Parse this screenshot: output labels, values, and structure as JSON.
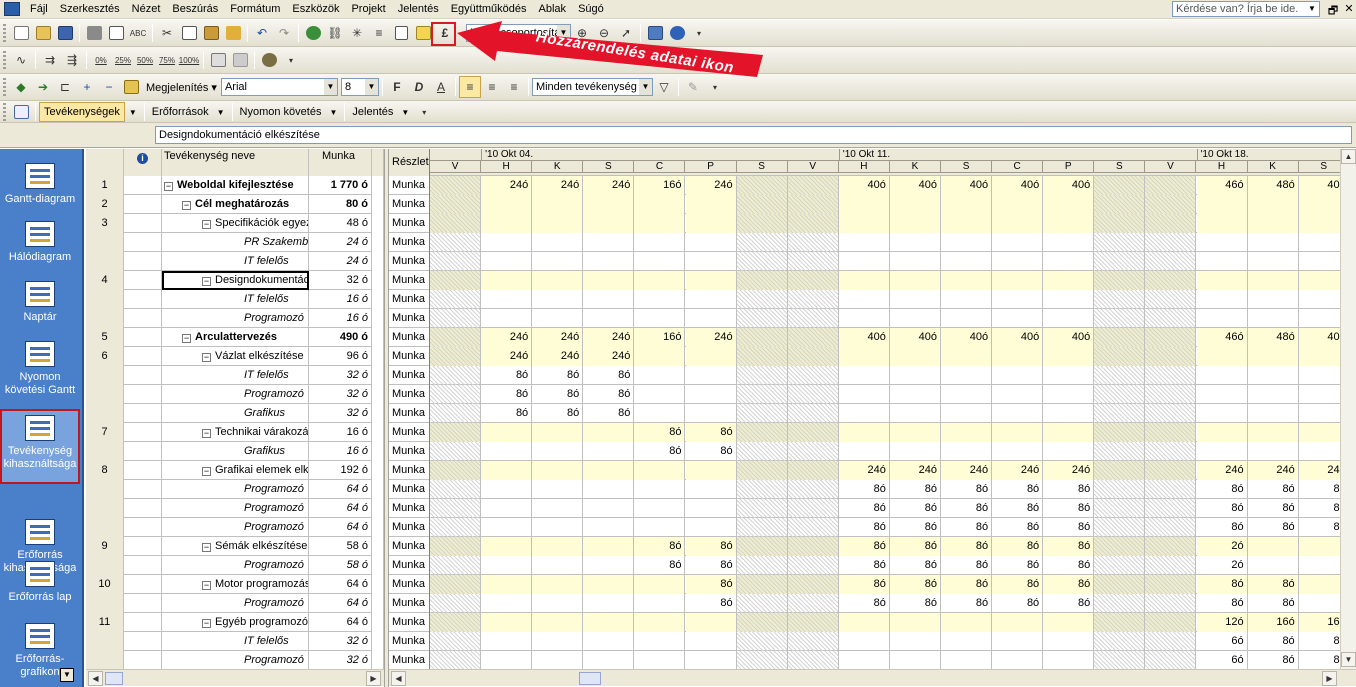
{
  "menu": {
    "items": [
      "Fájl",
      "Szerkesztés",
      "Nézet",
      "Beszúrás",
      "Formátum",
      "Eszközök",
      "Projekt",
      "Jelentés",
      "Együttműködés",
      "Ablak",
      "Súgó"
    ],
    "help_placeholder": "Kérdése van? Írja be ide."
  },
  "toolbar": {
    "grouping": "Nincs csoportosítás",
    "display_label": "Megjelenítés",
    "font": "Arial",
    "font_size": "8",
    "filter": "Minden tevékenység",
    "zoom_labels": [
      "0%",
      "25%",
      "50%",
      "75%",
      "100%"
    ],
    "bold": "F",
    "italic": "D",
    "underline": "A"
  },
  "viewtabs": {
    "tasks": "Tevékenységek",
    "resources": "Erőforrások",
    "tracking": "Nyomon követés",
    "report": "Jelentés"
  },
  "annotation": {
    "label": "Hozzárendelés adatai ikon",
    "color": "#e3142a"
  },
  "entry_value": "Designdokumentáció elkészítése",
  "viewbar": [
    {
      "label": "Gantt-diagram",
      "icon": "gantt-icon"
    },
    {
      "label": "Hálódiagram",
      "icon": "network-icon"
    },
    {
      "label": "Naptár",
      "icon": "calendar-icon"
    },
    {
      "label": "Nyomon követési Gantt",
      "icon": "tracking-gantt-icon"
    },
    {
      "label": "Tevékenység kihasználtsága",
      "icon": "task-usage-icon",
      "active": true
    },
    {
      "label": "Erőforrás kihasználtsága",
      "icon": "resource-usage-icon"
    },
    {
      "label": "Erőforrás lap",
      "icon": "resource-sheet-icon"
    },
    {
      "label": "Erőforrás-grafikon",
      "icon": "resource-graph-icon"
    }
  ],
  "table": {
    "headers": {
      "indicator": "i",
      "name": "Tevékenység neve",
      "work": "Munka"
    },
    "rows": [
      {
        "id": "1",
        "name": "Weboldal kifejlesztése",
        "work": "1 770 ó",
        "lvl": 0,
        "type": "sum"
      },
      {
        "id": "2",
        "name": "Cél meghatározás",
        "work": "80 ó",
        "lvl": 1,
        "type": "sum"
      },
      {
        "id": "3",
        "name": "Specifikációk egyeztetése",
        "work": "48 ó",
        "lvl": 2,
        "type": "task"
      },
      {
        "id": "",
        "name": "PR Szakember",
        "work": "24 ó",
        "lvl": 3,
        "type": "res"
      },
      {
        "id": "",
        "name": "IT felelős",
        "work": "24 ó",
        "lvl": 3,
        "type": "res"
      },
      {
        "id": "4",
        "name": "Designdokumentáció elkészítése",
        "work": "32 ó",
        "lvl": 2,
        "type": "task",
        "selected": true
      },
      {
        "id": "",
        "name": "IT felelős",
        "work": "16 ó",
        "lvl": 3,
        "type": "res"
      },
      {
        "id": "",
        "name": "Programozó",
        "work": "16 ó",
        "lvl": 3,
        "type": "res"
      },
      {
        "id": "5",
        "name": "Arculattervezés",
        "work": "490 ó",
        "lvl": 1,
        "type": "sum"
      },
      {
        "id": "6",
        "name": "Vázlat elkészítése",
        "work": "96 ó",
        "lvl": 2,
        "type": "task"
      },
      {
        "id": "",
        "name": "IT felelős",
        "work": "32 ó",
        "lvl": 3,
        "type": "res"
      },
      {
        "id": "",
        "name": "Programozó",
        "work": "32 ó",
        "lvl": 3,
        "type": "res"
      },
      {
        "id": "",
        "name": "Grafikus",
        "work": "32 ó",
        "lvl": 3,
        "type": "res"
      },
      {
        "id": "7",
        "name": "Technikai várakozás",
        "work": "16 ó",
        "lvl": 2,
        "type": "task"
      },
      {
        "id": "",
        "name": "Grafikus",
        "work": "16 ó",
        "lvl": 3,
        "type": "res"
      },
      {
        "id": "8",
        "name": "Grafikai elemek elkészítése",
        "work": "192 ó",
        "lvl": 2,
        "type": "task"
      },
      {
        "id": "",
        "name": "Programozó",
        "work": "64 ó",
        "lvl": 3,
        "type": "res"
      },
      {
        "id": "",
        "name": "Programozó",
        "work": "64 ó",
        "lvl": 3,
        "type": "res"
      },
      {
        "id": "",
        "name": "Programozó",
        "work": "64 ó",
        "lvl": 3,
        "type": "res"
      },
      {
        "id": "9",
        "name": "Sémák elkészítése",
        "work": "58 ó",
        "lvl": 2,
        "type": "task"
      },
      {
        "id": "",
        "name": "Programozó",
        "work": "58 ó",
        "lvl": 3,
        "type": "res"
      },
      {
        "id": "10",
        "name": "Motor programozása",
        "work": "64 ó",
        "lvl": 2,
        "type": "task"
      },
      {
        "id": "",
        "name": "Programozó",
        "work": "64 ó",
        "lvl": 3,
        "type": "res"
      },
      {
        "id": "11",
        "name": "Egyéb programozói feladatok",
        "work": "64 ó",
        "lvl": 2,
        "type": "task"
      },
      {
        "id": "",
        "name": "IT felelős",
        "work": "32 ó",
        "lvl": 3,
        "type": "res"
      },
      {
        "id": "",
        "name": "Programozó",
        "work": "32 ó",
        "lvl": 3,
        "type": "res"
      }
    ]
  },
  "timescale": {
    "detail_header": "Részlet",
    "detail_label": "Munka",
    "weeks": [
      {
        "label": "'10 Okt 04.",
        "start": 1
      },
      {
        "label": "'10 Okt 11.",
        "start": 8
      },
      {
        "label": "'10 Okt 18.",
        "start": 15
      }
    ],
    "days": [
      "V",
      "H",
      "K",
      "S",
      "C",
      "P",
      "S",
      "V",
      "H",
      "K",
      "S",
      "C",
      "P",
      "S",
      "V",
      "H",
      "K",
      "S"
    ],
    "weekend_cols": [
      0,
      6,
      7,
      13,
      14
    ],
    "values": [
      [
        "",
        "24ó",
        "24ó",
        "24ó",
        "16ó",
        "24ó",
        "",
        "",
        "40ó",
        "40ó",
        "40ó",
        "40ó",
        "40ó",
        "",
        "",
        "46ó",
        "48ó",
        "40ó"
      ],
      [
        "",
        "",
        "",
        "",
        "",
        "",
        "",
        "",
        "",
        "",
        "",
        "",
        "",
        "",
        "",
        "",
        "",
        ""
      ],
      [
        "",
        "",
        "",
        "",
        "",
        "",
        "",
        "",
        "",
        "",
        "",
        "",
        "",
        "",
        "",
        "",
        "",
        ""
      ],
      [
        "",
        "",
        "",
        "",
        "",
        "",
        "",
        "",
        "",
        "",
        "",
        "",
        "",
        "",
        "",
        "",
        "",
        ""
      ],
      [
        "",
        "",
        "",
        "",
        "",
        "",
        "",
        "",
        "",
        "",
        "",
        "",
        "",
        "",
        "",
        "",
        "",
        ""
      ],
      [
        "",
        "",
        "",
        "",
        "",
        "",
        "",
        "",
        "",
        "",
        "",
        "",
        "",
        "",
        "",
        "",
        "",
        ""
      ],
      [
        "",
        "",
        "",
        "",
        "",
        "",
        "",
        "",
        "",
        "",
        "",
        "",
        "",
        "",
        "",
        "",
        "",
        ""
      ],
      [
        "",
        "",
        "",
        "",
        "",
        "",
        "",
        "",
        "",
        "",
        "",
        "",
        "",
        "",
        "",
        "",
        "",
        ""
      ],
      [
        "",
        "24ó",
        "24ó",
        "24ó",
        "16ó",
        "24ó",
        "",
        "",
        "40ó",
        "40ó",
        "40ó",
        "40ó",
        "40ó",
        "",
        "",
        "46ó",
        "48ó",
        "40ó"
      ],
      [
        "",
        "24ó",
        "24ó",
        "24ó",
        "",
        "",
        "",
        "",
        "",
        "",
        "",
        "",
        "",
        "",
        "",
        "",
        "",
        ""
      ],
      [
        "",
        "8ó",
        "8ó",
        "8ó",
        "",
        "",
        "",
        "",
        "",
        "",
        "",
        "",
        "",
        "",
        "",
        "",
        "",
        ""
      ],
      [
        "",
        "8ó",
        "8ó",
        "8ó",
        "",
        "",
        "",
        "",
        "",
        "",
        "",
        "",
        "",
        "",
        "",
        "",
        "",
        ""
      ],
      [
        "",
        "8ó",
        "8ó",
        "8ó",
        "",
        "",
        "",
        "",
        "",
        "",
        "",
        "",
        "",
        "",
        "",
        "",
        "",
        ""
      ],
      [
        "",
        "",
        "",
        "",
        "8ó",
        "8ó",
        "",
        "",
        "",
        "",
        "",
        "",
        "",
        "",
        "",
        "",
        "",
        ""
      ],
      [
        "",
        "",
        "",
        "",
        "8ó",
        "8ó",
        "",
        "",
        "",
        "",
        "",
        "",
        "",
        "",
        "",
        "",
        "",
        ""
      ],
      [
        "",
        "",
        "",
        "",
        "",
        "",
        "",
        "",
        "24ó",
        "24ó",
        "24ó",
        "24ó",
        "24ó",
        "",
        "",
        "24ó",
        "24ó",
        "24ó"
      ],
      [
        "",
        "",
        "",
        "",
        "",
        "",
        "",
        "",
        "8ó",
        "8ó",
        "8ó",
        "8ó",
        "8ó",
        "",
        "",
        "8ó",
        "8ó",
        "8ó"
      ],
      [
        "",
        "",
        "",
        "",
        "",
        "",
        "",
        "",
        "8ó",
        "8ó",
        "8ó",
        "8ó",
        "8ó",
        "",
        "",
        "8ó",
        "8ó",
        "8ó"
      ],
      [
        "",
        "",
        "",
        "",
        "",
        "",
        "",
        "",
        "8ó",
        "8ó",
        "8ó",
        "8ó",
        "8ó",
        "",
        "",
        "8ó",
        "8ó",
        "8ó"
      ],
      [
        "",
        "",
        "",
        "",
        "8ó",
        "8ó",
        "",
        "",
        "8ó",
        "8ó",
        "8ó",
        "8ó",
        "8ó",
        "",
        "",
        "2ó",
        "",
        ""
      ],
      [
        "",
        "",
        "",
        "",
        "8ó",
        "8ó",
        "",
        "",
        "8ó",
        "8ó",
        "8ó",
        "8ó",
        "8ó",
        "",
        "",
        "2ó",
        "",
        ""
      ],
      [
        "",
        "",
        "",
        "",
        "",
        "8ó",
        "",
        "",
        "8ó",
        "8ó",
        "8ó",
        "8ó",
        "8ó",
        "",
        "",
        "8ó",
        "8ó",
        ""
      ],
      [
        "",
        "",
        "",
        "",
        "",
        "8ó",
        "",
        "",
        "8ó",
        "8ó",
        "8ó",
        "8ó",
        "8ó",
        "",
        "",
        "8ó",
        "8ó",
        ""
      ],
      [
        "",
        "",
        "",
        "",
        "",
        "",
        "",
        "",
        "",
        "",
        "",
        "",
        "",
        "",
        "",
        "12ó",
        "16ó",
        "16ó"
      ],
      [
        "",
        "",
        "",
        "",
        "",
        "",
        "",
        "",
        "",
        "",
        "",
        "",
        "",
        "",
        "",
        "6ó",
        "8ó",
        "8ó"
      ],
      [
        "",
        "",
        "",
        "",
        "",
        "",
        "",
        "",
        "",
        "",
        "",
        "",
        "",
        "",
        "",
        "6ó",
        "8ó",
        "8ó"
      ]
    ]
  }
}
